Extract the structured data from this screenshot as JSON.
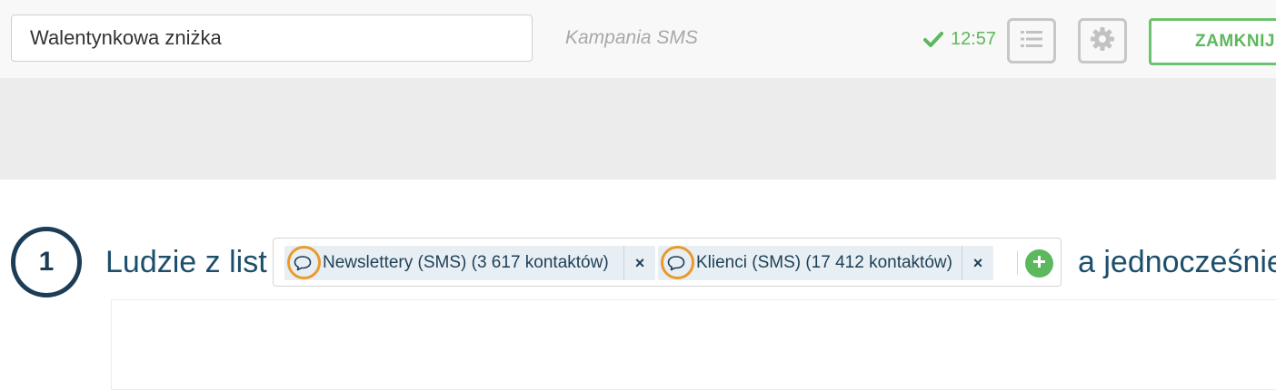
{
  "header": {
    "campaign_name": "Walentynkowa zniżka",
    "campaign_type": "Kampania SMS",
    "save_time": "12:57",
    "close_label": "ZAMKNIJ",
    "colors": {
      "accent_green": "#5cb85c",
      "dark_blue": "#1d3d57",
      "highlight_orange": "#e99a2c"
    },
    "icons": [
      "check-icon",
      "list-icon",
      "gear-icon"
    ]
  },
  "step": {
    "number": "1",
    "heading": "Ludzie z list",
    "tail": "a jednocześnie",
    "lists": [
      {
        "label": "Newslettery (SMS) (3 617 kontaktów)",
        "remove": "×",
        "icon": "speech-bubble-icon"
      },
      {
        "label": "Klienci (SMS) (17 412 kontaktów)",
        "remove": "×",
        "icon": "speech-bubble-icon"
      }
    ],
    "add_icon": "plus-icon"
  }
}
